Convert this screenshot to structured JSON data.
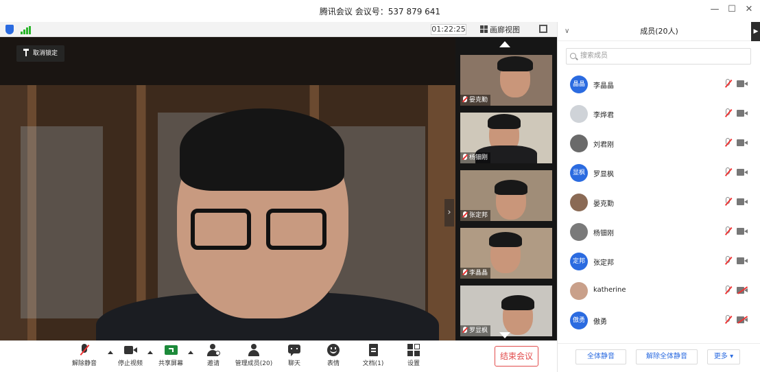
{
  "window": {
    "title": "腾讯会议 会议号：537 879 641",
    "controls": {
      "minimize": "—",
      "maximize": "☐",
      "close": "✕"
    }
  },
  "status": {
    "timer": "01:22:25",
    "view_label": "画廊视图"
  },
  "main_video": {
    "unlock_label": "取消锁定"
  },
  "thumbnails": [
    {
      "name": "晏克勤"
    },
    {
      "name": "杨钿刚"
    },
    {
      "name": "张定邦"
    },
    {
      "name": "李晶晶"
    },
    {
      "name": "罗显枫"
    }
  ],
  "toolbar": {
    "unmute": "解除静音",
    "stop_video": "停止视频",
    "share_screen": "共享屏幕",
    "invite": "邀请",
    "manage_members": "管理成员(20)",
    "chat": "聊天",
    "emoji": "表情",
    "docs": "文档(1)",
    "settings": "设置",
    "end_meeting": "结束会议"
  },
  "panel": {
    "collapse": "∨",
    "title": "成员(20人)",
    "side_tab": "▶",
    "search_placeholder": "搜索成员",
    "members": [
      {
        "name": "李晶晶",
        "avatar_text": "晶晶",
        "avatar_color": "#2b6be0",
        "camera_off": false
      },
      {
        "name": "李烨君",
        "avatar_text": "",
        "avatar_color": "#cfd3d8",
        "camera_off": false
      },
      {
        "name": "刘君刚",
        "avatar_text": "",
        "avatar_color": "#6a6a6a",
        "camera_off": false
      },
      {
        "name": "罗显枫",
        "avatar_text": "显枫",
        "avatar_color": "#2b6be0",
        "camera_off": false
      },
      {
        "name": "晏克勤",
        "avatar_text": "",
        "avatar_color": "#8a6a55",
        "camera_off": false
      },
      {
        "name": "杨钿刚",
        "avatar_text": "",
        "avatar_color": "#7a7a7a",
        "camera_off": false
      },
      {
        "name": "张定邦",
        "avatar_text": "定邦",
        "avatar_color": "#2b6be0",
        "camera_off": false
      },
      {
        "name": "katherine",
        "avatar_text": "",
        "avatar_color": "#c9a08a",
        "camera_off": true
      },
      {
        "name": "傲勇",
        "avatar_text": "傲勇",
        "avatar_color": "#2b6be0",
        "camera_off": true
      }
    ],
    "mute_all": "全体静音",
    "unmute_all": "解除全体静音",
    "more": "更多 ▾"
  }
}
